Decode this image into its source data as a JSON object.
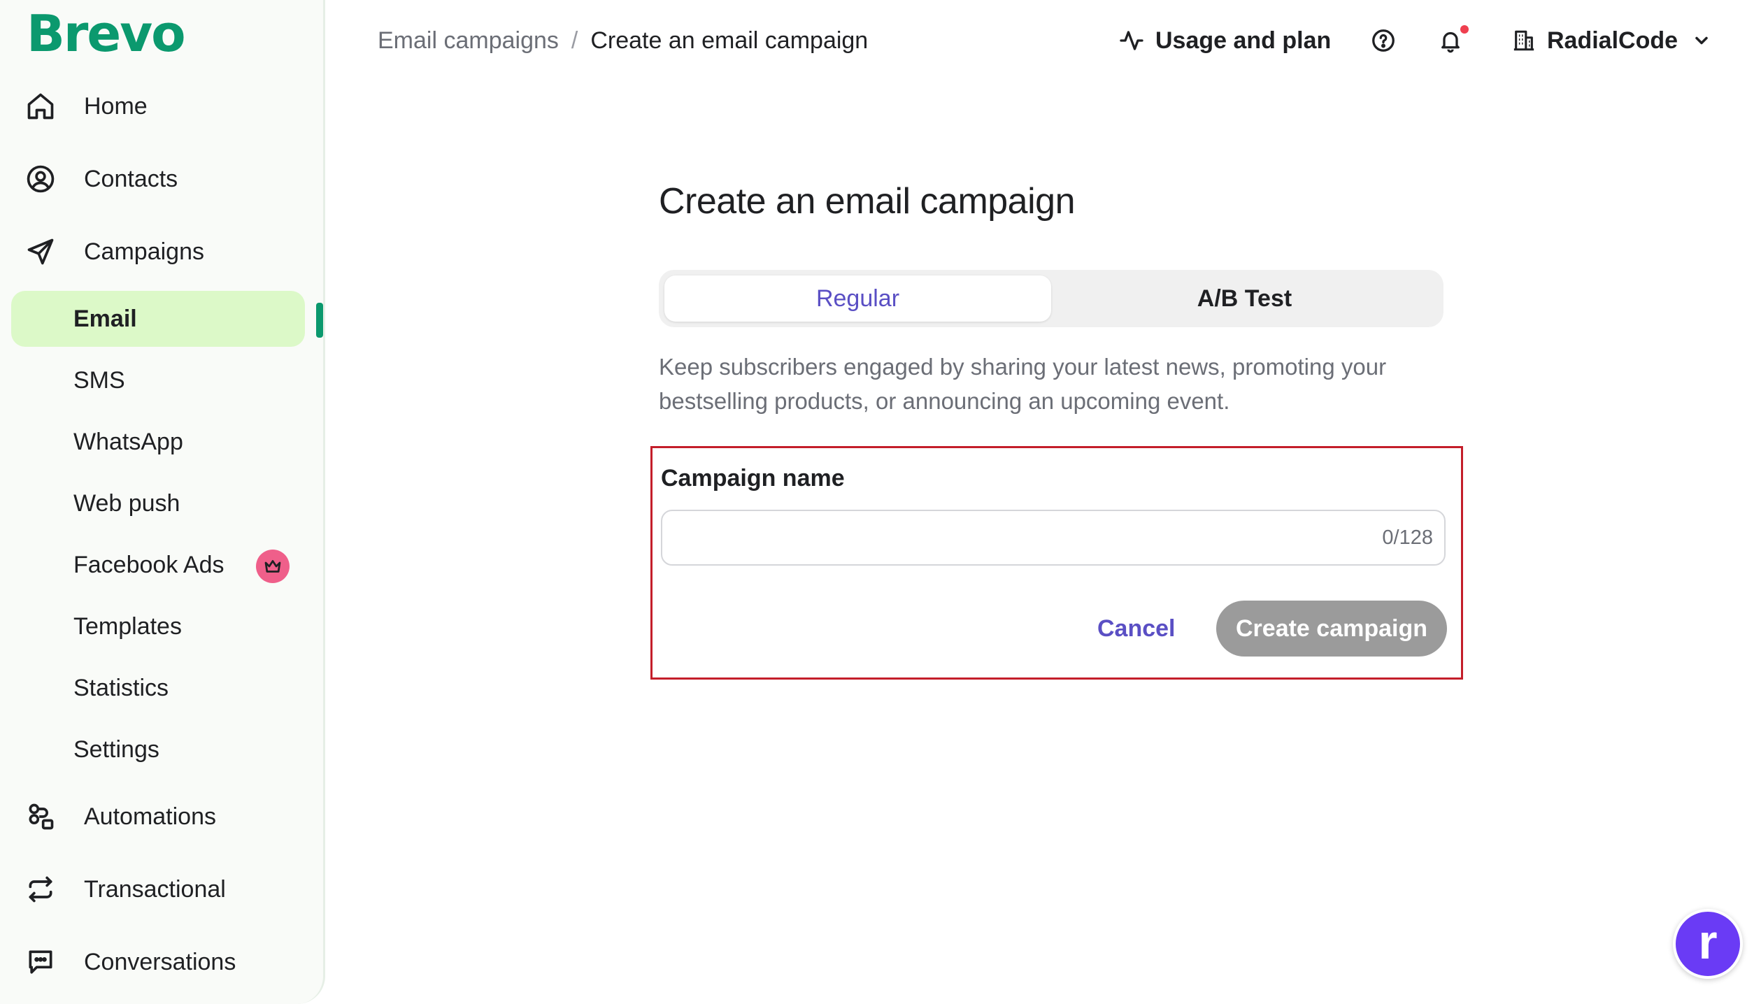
{
  "brand": {
    "logo_text": "Brevo",
    "color": "#0b996e"
  },
  "sidebar": {
    "items": [
      {
        "label": "Home",
        "icon": "home-icon"
      },
      {
        "label": "Contacts",
        "icon": "contacts-icon"
      },
      {
        "label": "Campaigns",
        "icon": "send-icon"
      },
      {
        "label": "Automations",
        "icon": "automations-icon"
      },
      {
        "label": "Transactional",
        "icon": "transactional-icon"
      },
      {
        "label": "Conversations",
        "icon": "conversations-icon"
      }
    ],
    "campaign_subitems": [
      {
        "label": "Email",
        "active": true
      },
      {
        "label": "SMS"
      },
      {
        "label": "WhatsApp"
      },
      {
        "label": "Web push"
      },
      {
        "label": "Facebook Ads",
        "badge": "crown-icon"
      },
      {
        "label": "Templates"
      },
      {
        "label": "Statistics"
      },
      {
        "label": "Settings"
      }
    ],
    "active_color": "#dcf9c8"
  },
  "header": {
    "breadcrumb": {
      "parent": "Email campaigns",
      "separator": "/",
      "current": "Create an email campaign"
    },
    "usage_label": "Usage and plan",
    "account_name": "RadialCode"
  },
  "main": {
    "title": "Create an email campaign",
    "tabs": [
      {
        "label": "Regular",
        "selected": true
      },
      {
        "label": "A/B Test",
        "selected": false
      }
    ],
    "description": "Keep subscribers engaged by sharing your latest news, promoting your bestselling products, or announcing an upcoming event.",
    "form": {
      "field_label": "Campaign name",
      "value": "",
      "char_count": "0/128",
      "cancel_label": "Cancel",
      "create_label": "Create campaign"
    },
    "accent_color": "#5a4fc4",
    "highlight_border_color": "#c41e2a"
  },
  "fab": {
    "letter": "r",
    "color": "#6a3bf5"
  }
}
